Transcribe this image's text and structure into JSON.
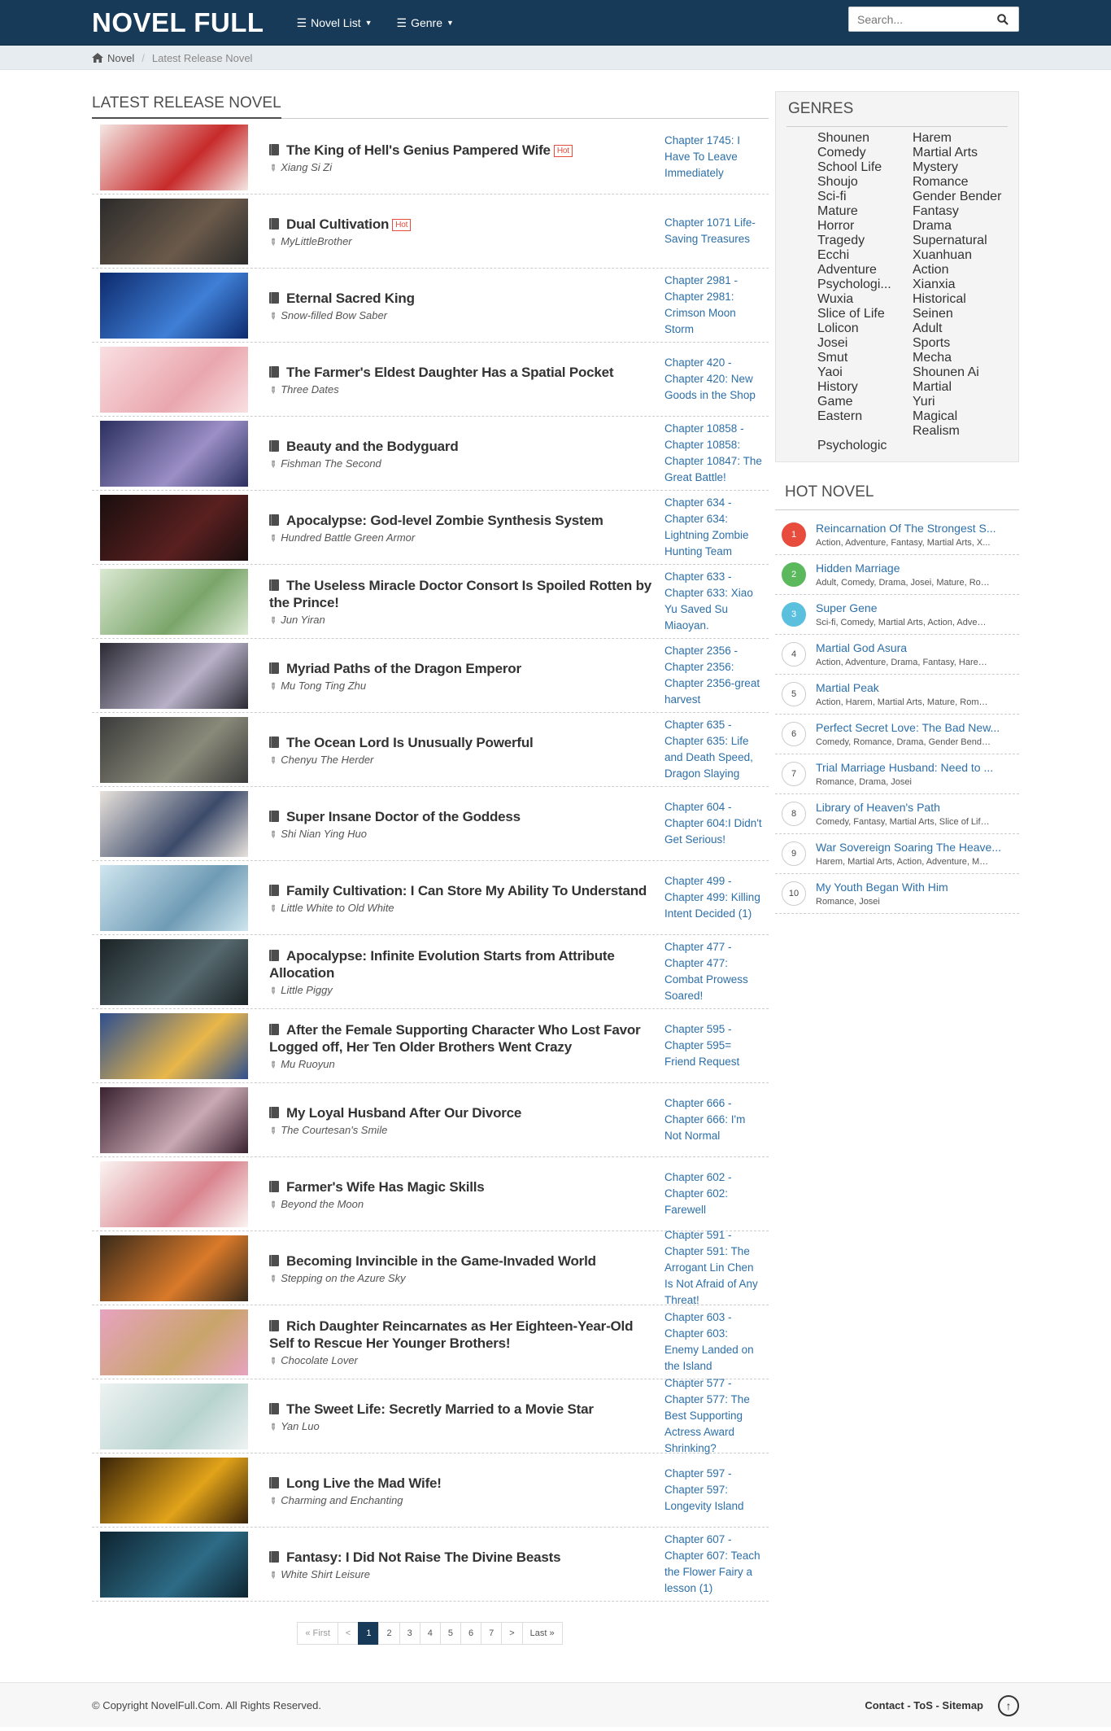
{
  "header": {
    "logo": "NOVEL FULL",
    "nav": [
      {
        "label": "Novel List"
      },
      {
        "label": "Genre"
      }
    ],
    "search_placeholder": "Search..."
  },
  "breadcrumb": {
    "home": "Novel",
    "current": "Latest Release Novel"
  },
  "latest": {
    "title": "LATEST RELEASE NOVEL",
    "hot_label": "Hot",
    "novels": [
      {
        "title": "The King of Hell's Genius Pampered Wife",
        "hot": true,
        "author": "Xiang Si Zi",
        "chapter": "Chapter 1745: I Have To Leave Immediately",
        "cover": [
          "#f4e7e4",
          "#c72a2a"
        ]
      },
      {
        "title": "Dual Cultivation",
        "hot": true,
        "author": "MyLittleBrother",
        "chapter": "Chapter 1071 Life-Saving Treasures",
        "cover": [
          "#2b2b2b",
          "#6b5a4a"
        ]
      },
      {
        "title": "Eternal Sacred King",
        "hot": false,
        "author": "Snow-filled Bow Saber",
        "chapter": "Chapter 2981 - Chapter 2981: Crimson Moon Storm",
        "cover": [
          "#0d2a6d",
          "#3f7fd6"
        ]
      },
      {
        "title": "The Farmer's Eldest Daughter Has a Spatial Pocket",
        "hot": false,
        "author": "Three Dates",
        "chapter": "Chapter 420 - Chapter 420: New Goods in the Shop",
        "cover": [
          "#f9dfe2",
          "#e9a6ad"
        ]
      },
      {
        "title": "Beauty and the Bodyguard",
        "hot": false,
        "author": "Fishman The Second",
        "chapter": "Chapter 10858 - Chapter 10858: Chapter 10847: The Great Battle!",
        "cover": [
          "#2a2f5f",
          "#9b8fc6"
        ]
      },
      {
        "title": "Apocalypse: God-level Zombie Synthesis System",
        "hot": false,
        "author": "Hundred Battle Green Armor",
        "chapter": "Chapter 634 - Chapter 634: Lightning Zombie Hunting Team",
        "cover": [
          "#1a0e0e",
          "#5a2020"
        ]
      },
      {
        "title": "The Useless Miracle Doctor Consort Is Spoiled Rotten by the Prince!",
        "hot": false,
        "author": "Jun Yiran",
        "chapter": "Chapter 633 - Chapter 633: Xiao Yu Saved Su Miaoyan.",
        "cover": [
          "#dbe9d2",
          "#7aa56a"
        ]
      },
      {
        "title": "Myriad Paths of the Dragon Emperor",
        "hot": false,
        "author": "Mu Tong Ting Zhu",
        "chapter": "Chapter 2356 - Chapter 2356: Chapter 2356-great harvest",
        "cover": [
          "#2a2a33",
          "#b7b0c7"
        ]
      },
      {
        "title": "The Ocean Lord Is Unusually Powerful",
        "hot": false,
        "author": "Chenyu The Herder",
        "chapter": "Chapter 635 - Chapter 635: Life and Death Speed, Dragon Slaying",
        "cover": [
          "#3b3b3b",
          "#8a8a7a"
        ]
      },
      {
        "title": "Super Insane Doctor of the Goddess",
        "hot": false,
        "author": "Shi Nian Ying Huo",
        "chapter": "Chapter 604 - Chapter 604:I Didn't Get Serious!",
        "cover": [
          "#e8e2dc",
          "#3c4a6a"
        ]
      },
      {
        "title": "Family Cultivation: I Can Store My Ability To Understand",
        "hot": false,
        "author": "Little White to Old White",
        "chapter": "Chapter 499 - Chapter 499: Killing Intent Decided (1)",
        "cover": [
          "#cfe6ef",
          "#6f9bb5"
        ]
      },
      {
        "title": "Apocalypse: Infinite Evolution Starts from Attribute Allocation",
        "hot": false,
        "author": "Little Piggy",
        "chapter": "Chapter 477 - Chapter 477: Combat Prowess Soared!",
        "cover": [
          "#1b2326",
          "#55686d"
        ]
      },
      {
        "title": "After the Female Supporting Character Who Lost Favor Logged off, Her Ten Older Brothers Went Crazy",
        "hot": false,
        "author": "Mu Ruoyun",
        "chapter": "Chapter 595 - Chapter 595= Friend Request",
        "cover": [
          "#2e4f8e",
          "#e9b74a"
        ]
      },
      {
        "title": "My Loyal Husband After Our Divorce",
        "hot": false,
        "author": "The Courtesan's Smile",
        "chapter": "Chapter 666 - Chapter 666: I'm Not Normal",
        "cover": [
          "#3a2230",
          "#c9a9b3"
        ]
      },
      {
        "title": "Farmer's Wife Has Magic Skills",
        "hot": false,
        "author": "Beyond the Moon",
        "chapter": "Chapter 602 - Chapter 602: Farewell",
        "cover": [
          "#fbf4f2",
          "#d9848e"
        ]
      },
      {
        "title": "Becoming Invincible in the Game-Invaded World",
        "hot": false,
        "author": "Stepping on the Azure Sky",
        "chapter": "Chapter 591 - Chapter 591: The Arrogant Lin Chen Is Not Afraid of Any Threat!",
        "cover": [
          "#3a2a1a",
          "#d97a2a"
        ]
      },
      {
        "title": "Rich Daughter Reincarnates as Her Eighteen-Year-Old Self to Rescue Her Younger Brothers!",
        "hot": false,
        "author": "Chocolate Lover",
        "chapter": "Chapter 603 - Chapter 603: Enemy Landed on the Island",
        "cover": [
          "#e7a3c0",
          "#c9a46a"
        ]
      },
      {
        "title": "The Sweet Life: Secretly Married to a Movie Star",
        "hot": false,
        "author": "Yan Luo",
        "chapter": "Chapter 577 - Chapter 577: The Best Supporting Actress Award Shrinking?",
        "cover": [
          "#eef3f2",
          "#b8d3cf"
        ]
      },
      {
        "title": "Long Live the Mad Wife!",
        "hot": false,
        "author": "Charming and Enchanting",
        "chapter": "Chapter 597 - Chapter 597: Longevity Island",
        "cover": [
          "#3a2408",
          "#e2a31a"
        ]
      },
      {
        "title": "Fantasy: I Did Not Raise The Divine Beasts",
        "hot": false,
        "author": "White Shirt Leisure",
        "chapter": "Chapter 607 - Chapter 607: Teach the Flower Fairy a lesson (1)",
        "cover": [
          "#0e2430",
          "#2d6b86"
        ]
      }
    ]
  },
  "pagination": [
    "« First",
    "<",
    "1",
    "2",
    "3",
    "4",
    "5",
    "6",
    "7",
    ">",
    "Last »"
  ],
  "genres": {
    "title": "GENRES",
    "items": [
      "Shounen",
      "Harem",
      "Comedy",
      "Martial Arts",
      "School Life",
      "Mystery",
      "Shoujo",
      "Romance",
      "Sci-fi",
      "Gender Bender",
      "Mature",
      "Fantasy",
      "Horror",
      "Drama",
      "Tragedy",
      "Supernatural",
      "Ecchi",
      "Xuanhuan",
      "Adventure",
      "Action",
      "Psychologi...",
      "Xianxia",
      "Wuxia",
      "Historical",
      "Slice of Life",
      "Seinen",
      "Lolicon",
      "Adult",
      "Josei",
      "Sports",
      "Smut",
      "Mecha",
      "Yaoi",
      "Shounen Ai",
      "History",
      "Martial",
      "Game",
      "Yuri",
      "Eastern",
      "Magical Realism",
      "Psychologic"
    ]
  },
  "hot_novel": {
    "title": "HOT NOVEL",
    "items": [
      {
        "rank": "1",
        "name": "Reincarnation Of The Strongest S...",
        "cats": "Action, Adventure, Fantasy, Martial Arts, X..."
      },
      {
        "rank": "2",
        "name": "Hidden Marriage",
        "cats": "Adult, Comedy, Drama, Josei, Mature, Rom..."
      },
      {
        "rank": "3",
        "name": "Super Gene",
        "cats": "Sci-fi, Comedy, Martial Arts, Action, Advent..."
      },
      {
        "rank": "4",
        "name": "Martial God Asura",
        "cats": "Action, Adventure, Drama, Fantasy, Harem,..."
      },
      {
        "rank": "5",
        "name": "Martial Peak",
        "cats": "Action, Harem, Martial Arts, Mature, Roma..."
      },
      {
        "rank": "6",
        "name": "Perfect Secret Love: The Bad New...",
        "cats": "Comedy, Romance, Drama, Gender Bender,..."
      },
      {
        "rank": "7",
        "name": "Trial Marriage Husband: Need to ...",
        "cats": "Romance, Drama, Josei"
      },
      {
        "rank": "8",
        "name": "Library of Heaven's Path",
        "cats": "Comedy, Fantasy, Martial Arts, Slice of Life..."
      },
      {
        "rank": "9",
        "name": "War Sovereign Soaring The Heave...",
        "cats": "Harem, Martial Arts, Action, Adventure, Ma..."
      },
      {
        "rank": "10",
        "name": "My Youth Began With Him",
        "cats": "Romance, Josei"
      }
    ]
  },
  "footer": {
    "copyright": "© Copyright NovelFull.Com. All Rights Reserved.",
    "links": "Contact - ToS - Sitemap"
  }
}
